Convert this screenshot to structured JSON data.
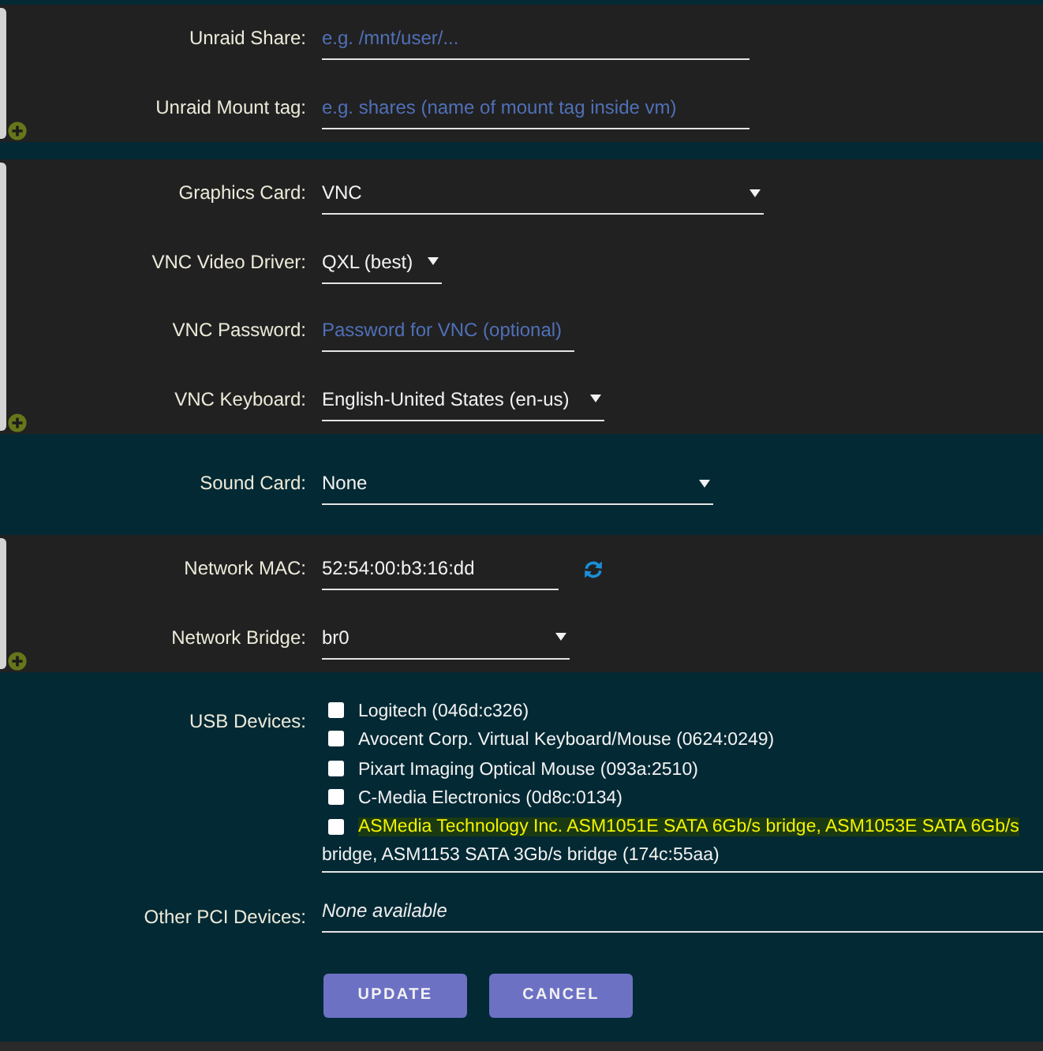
{
  "sections": [
    {
      "kind": "group",
      "rows": [
        {
          "kind": "text",
          "label": "Unraid Share:",
          "placeholder": "e.g. /mnt/user/..."
        },
        {
          "kind": "text",
          "label": "Unraid Mount tag:",
          "placeholder": "e.g. shares (name of mount tag inside vm)"
        }
      ]
    },
    {
      "kind": "group",
      "rows": [
        {
          "kind": "select",
          "label": "Graphics Card:",
          "value": "VNC"
        },
        {
          "kind": "select",
          "label": "VNC Video Driver:",
          "value": "QXL (best)"
        },
        {
          "kind": "text",
          "label": "VNC Password:",
          "placeholder": "Password for VNC (optional)"
        },
        {
          "kind": "select",
          "label": "VNC Keyboard:",
          "value": "English-United States (en-us)"
        }
      ]
    },
    {
      "kind": "plain",
      "rows": [
        {
          "kind": "select",
          "label": "Sound Card:",
          "value": "None"
        }
      ]
    },
    {
      "kind": "group",
      "rows": [
        {
          "kind": "generate",
          "label": "Network MAC:",
          "value": "52:54:00:b3:16:dd"
        },
        {
          "kind": "select",
          "label": "Network Bridge:",
          "value": "br0"
        }
      ]
    },
    {
      "kind": "plain",
      "rows": [
        {
          "kind": "checklist",
          "label": "USB Devices:",
          "items": [
            {
              "label": "Logitech (046d:c326)",
              "checked": false,
              "highlighted": false
            },
            {
              "label": "Avocent Corp. Virtual Keyboard/Mouse (0624:0249)",
              "checked": false,
              "highlighted": false
            },
            {
              "label": "Pixart Imaging Optical Mouse (093a:2510)",
              "checked": false,
              "highlighted": false
            },
            {
              "label": "C-Media Electronics (0d8c:0134)",
              "checked": false,
              "highlighted": false
            },
            {
              "label": "ASMedia Technology Inc. ASM1051E SATA 6Gb/s bridge, ASM1053E SATA 6Gb/s",
              "label_continued": "bridge, ASM1153 SATA 3Gb/s bridge (174c:55aa)",
              "checked": false,
              "highlighted": true
            }
          ]
        },
        {
          "kind": "static",
          "label": "Other PCI Devices:",
          "value": "None available"
        }
      ]
    }
  ],
  "buttons": [
    {
      "label": "UPDATE"
    },
    {
      "label": "CANCEL"
    }
  ]
}
